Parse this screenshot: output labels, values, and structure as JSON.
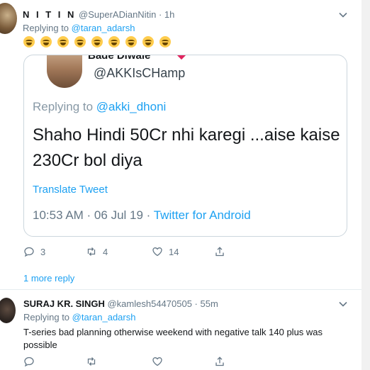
{
  "tweet1": {
    "name": "N I T I N",
    "handle": "@SuperADianNitin",
    "time": "1h",
    "replying_prefix": "Replying to ",
    "replying_to": "@taran_adarsh",
    "emoji_count": 9,
    "quote": {
      "top_name": "Bade Diwale",
      "handle": "@AKKIsCHamp",
      "replying_prefix": "Replying to ",
      "replying_to": "@akki_dhoni",
      "text": "Shaho Hindi 50Cr nhi karegi ...aise kaise 230Cr bol diya",
      "translate": "Translate Tweet",
      "datetime": "10:53 AM · 06 Jul 19 · ",
      "source": "Twitter for Android"
    },
    "actions": {
      "replies": "3",
      "retweets": "4",
      "likes": "14"
    },
    "more_replies": "1 more reply"
  },
  "tweet2": {
    "name": "SURAJ KR. SINGH",
    "handle": "@kamlesh54470505",
    "time": "55m",
    "replying_prefix": "Replying to ",
    "replying_to": "@taran_adarsh",
    "text": "T-series bad planning otherwise weekend with negative talk 140 plus was possible",
    "actions": {
      "replies": "",
      "retweets": "",
      "likes": ""
    }
  },
  "colors": {
    "accent": "#1da1f2",
    "secondary_text": "#657786",
    "border": "#ccd6dd"
  },
  "icons": [
    "chevron-down-icon",
    "reply-icon",
    "retweet-icon",
    "like-icon",
    "share-icon",
    "laughing-emoji-icon"
  ]
}
